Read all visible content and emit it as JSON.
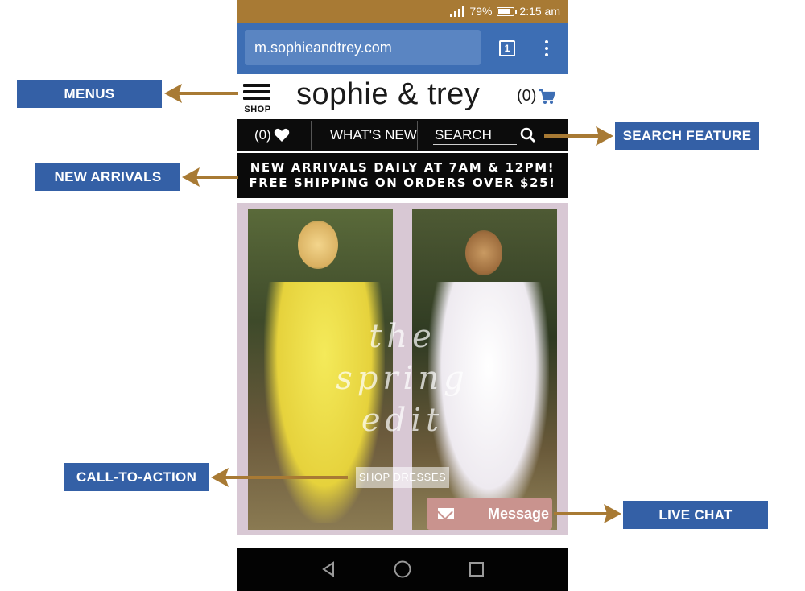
{
  "colors": {
    "status_bar": "#a87a34",
    "browser_bar": "#3d6eb4",
    "annotation_label": "#3460a6",
    "arrow": "#a87a34",
    "nav_bg": "#0c0c0c",
    "hero_bg": "#d8c8d4",
    "chat_button": "#c9938e"
  },
  "status_bar": {
    "battery": "79%",
    "time": "2:15 am",
    "icons": [
      "signal-icon",
      "battery-icon"
    ]
  },
  "browser": {
    "url": "m.sophieandtrey.com",
    "tab_count": "1",
    "icons": [
      "tabs-icon",
      "overflow-menu-icon"
    ]
  },
  "header": {
    "menu_label": "SHOP",
    "logo": "sophie & trey",
    "cart_count": "(0)",
    "icons": [
      "hamburger-menu-icon",
      "cart-icon"
    ]
  },
  "nav": {
    "wishlist_count": "(0)",
    "whats_new": "WHAT'S NEW",
    "search_placeholder": "SEARCH",
    "icons": [
      "heart-icon",
      "search-icon"
    ]
  },
  "promo": {
    "line1": "NEW ARRIVALS DAILY AT 7AM & 12PM!",
    "line2": "FREE SHIPPING ON ORDERS OVER $25!"
  },
  "hero": {
    "script_text": "the spring edit",
    "cta_label": "SHOP DRESSES"
  },
  "chat": {
    "label": "Message",
    "icons": [
      "envelope-icon"
    ]
  },
  "system_nav": {
    "icons": [
      "back-icon",
      "home-icon",
      "recents-icon"
    ]
  },
  "annotations": {
    "menus": "MENUS",
    "search_feature": "SEARCH FEATURE",
    "new_arrivals": "NEW ARRIVALS",
    "call_to_action": "CALL-TO-ACTION",
    "live_chat": "LIVE CHAT"
  }
}
